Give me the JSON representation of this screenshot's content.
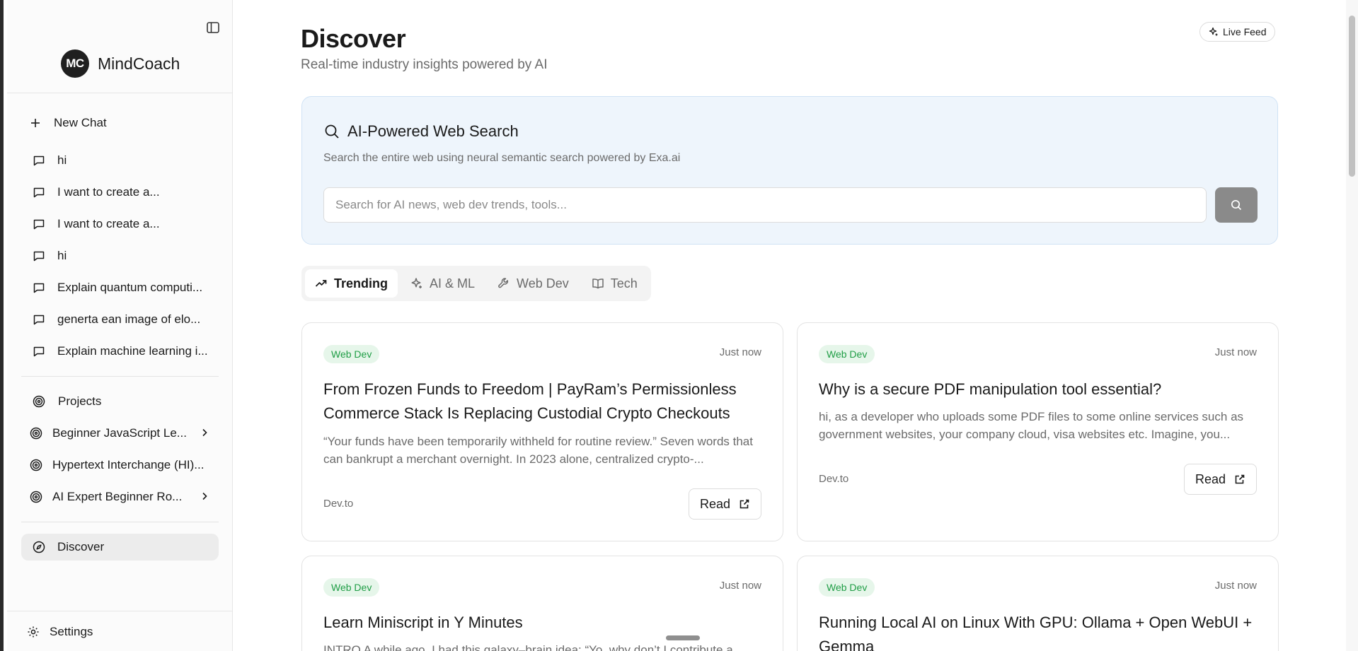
{
  "sidebar": {
    "brand_initials": "MC",
    "brand_name": "MindCoach",
    "new_chat_label": "New Chat",
    "chats": [
      "hi",
      "I want to create a...",
      "I want to create a...",
      "hi",
      "Explain quantum computi...",
      "generta ean image of elo...",
      "Explain machine learning i..."
    ],
    "projects_label": "Projects",
    "projects": [
      "Beginner JavaScript Le...",
      "Hypertext Interchange (HI)...",
      "AI Expert Beginner Ro..."
    ],
    "discover_label": "Discover",
    "settings_label": "Settings"
  },
  "header": {
    "title": "Discover",
    "subtitle": "Real-time industry insights powered by AI",
    "live_feed_label": "Live Feed"
  },
  "search": {
    "title": "AI-Powered Web Search",
    "description": "Search the entire web using neural semantic search powered by Exa.ai",
    "placeholder": "Search for AI news, web dev trends, tools..."
  },
  "tabs": [
    {
      "label": "Trending",
      "icon": "trending-up-icon",
      "active": true
    },
    {
      "label": "AI & ML",
      "icon": "sparkles-icon",
      "active": false
    },
    {
      "label": "Web Dev",
      "icon": "wrench-icon",
      "active": false
    },
    {
      "label": "Tech",
      "icon": "book-icon",
      "active": false
    }
  ],
  "articles": [
    {
      "tag": "Web Dev",
      "time": "Just now",
      "title": "From Frozen Funds to Freedom | PayRam’s Permissionless Commerce Stack Is Replacing Custodial Crypto Checkouts",
      "excerpt": "“Your funds have been temporarily withheld for routine review.” Seven words that can bankrupt a merchant overnight. In 2023 alone, centralized crypto-...",
      "source": "Dev.to",
      "read_label": "Read"
    },
    {
      "tag": "Web Dev",
      "time": "Just now",
      "title": "Why is a secure PDF manipulation tool essential?",
      "excerpt": "hi, as a developer who uploads some PDF files to some online services such as government websites, your company cloud, visa websites etc. Imagine, you...",
      "source": "Dev.to",
      "read_label": "Read"
    },
    {
      "tag": "Web Dev",
      "time": "Just now",
      "title": "Learn Miniscript in Y Minutes",
      "excerpt": "INTRO A while ago, I had this galaxy–brain idea: “Yo, why don’t I contribute a..."
    },
    {
      "tag": "Web Dev",
      "time": "Just now",
      "title": "Running Local AI on Linux With GPU: Ollama + Open WebUI + Gemma"
    }
  ],
  "colors": {
    "accent_dark": "#1f1f1f",
    "badge_green": "#1f9d45",
    "badge_bg": "#e6f6ea",
    "search_card_bg": "#eef5fc"
  }
}
